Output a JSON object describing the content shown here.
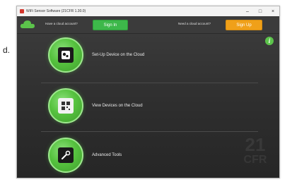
{
  "side_text": "d.",
  "window": {
    "title": "WiFi Sensor Software (21CFR 1.30.0)",
    "controls": {
      "minimize": "–",
      "maximize": "□",
      "close": "×"
    }
  },
  "topbar": {
    "cloud_question": "Have a cloud account?",
    "signin_label": "Sign In",
    "signup_question": "Need a cloud account?",
    "signup_label": "Sign Up"
  },
  "info": {
    "label": "i"
  },
  "menu": [
    {
      "label": "Set-Up Device on the Cloud",
      "icon": "device-setup-icon"
    },
    {
      "label": "View Devices on the Cloud",
      "icon": "view-devices-icon"
    },
    {
      "label": "Advanced Tools",
      "icon": "tools-icon"
    }
  ],
  "watermark": {
    "line1": "21",
    "line2": "CFR"
  },
  "colors": {
    "green": "#56c23f",
    "orange": "#f0a019",
    "dark": "#2e2e2e"
  }
}
